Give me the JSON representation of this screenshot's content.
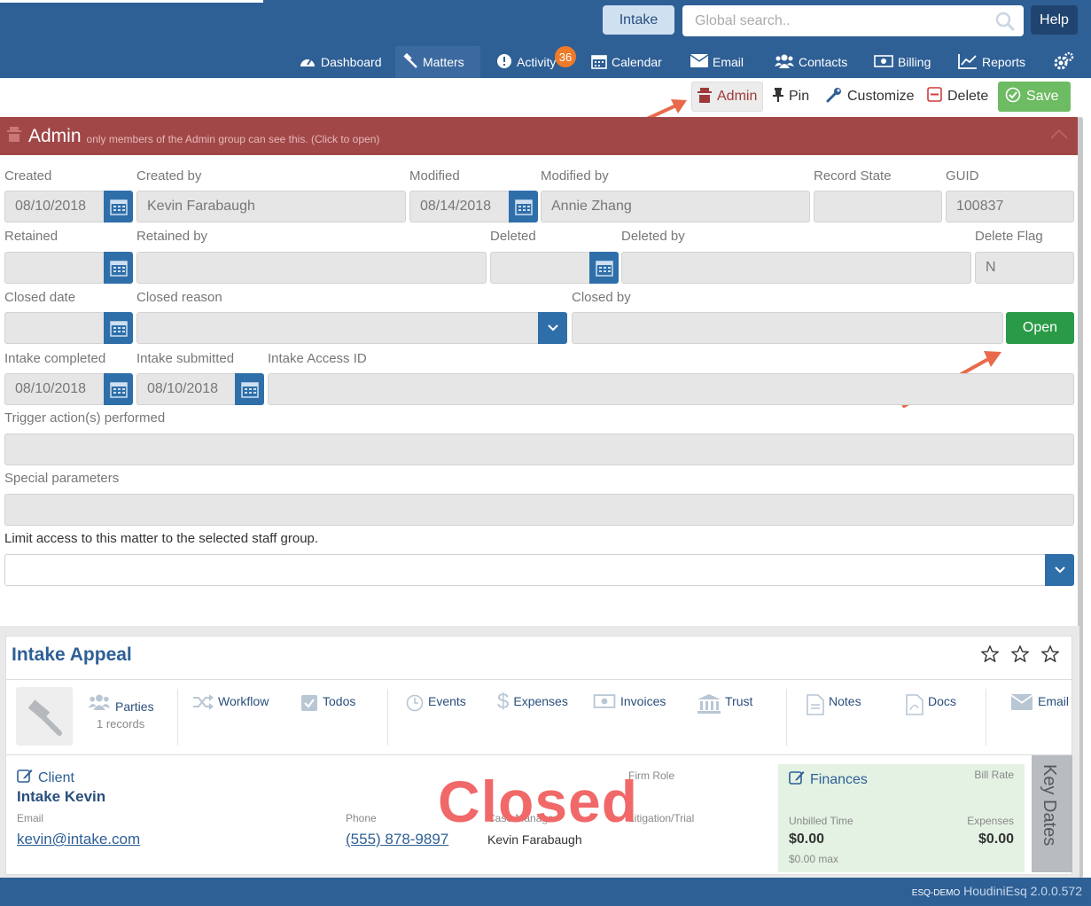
{
  "header": {
    "intake_label": "Intake",
    "search_placeholder": "Global search..",
    "help_label": "Help"
  },
  "nav": {
    "dashboard": "Dashboard",
    "matters": "Matters",
    "activity": "Activity",
    "activity_badge": "36",
    "calendar": "Calendar",
    "email": "Email",
    "contacts": "Contacts",
    "billing": "Billing",
    "reports": "Reports"
  },
  "actions": {
    "admin": "Admin",
    "pin": "Pin",
    "customize": "Customize",
    "delete": "Delete",
    "save": "Save"
  },
  "admin_section": {
    "title": "Admin",
    "subtitle": "only members of the Admin group can see this. (Click to open)"
  },
  "form": {
    "created_label": "Created",
    "created_value": "08/10/2018",
    "created_by_label": "Created by",
    "created_by_value": "Kevin Farabaugh",
    "modified_label": "Modified",
    "modified_value": "08/14/2018",
    "modified_by_label": "Modified by",
    "modified_by_value": "Annie Zhang",
    "record_state_label": "Record State",
    "record_state_value": "",
    "guid_label": "GUID",
    "guid_value": "100837",
    "retained_label": "Retained",
    "retained_by_label": "Retained by",
    "deleted_label": "Deleted",
    "deleted_by_label": "Deleted by",
    "delete_flag_label": "Delete Flag",
    "delete_flag_value": "N",
    "closed_date_label": "Closed date",
    "closed_reason_label": "Closed reason",
    "closed_by_label": "Closed by",
    "open_button": "Open",
    "intake_completed_label": "Intake completed",
    "intake_completed_value": "08/10/2018",
    "intake_submitted_label": "Intake submitted",
    "intake_submitted_value": "08/10/2018",
    "intake_access_id_label": "Intake Access ID",
    "trigger_label": "Trigger action(s) performed",
    "special_params_label": "Special parameters",
    "limit_access_label": "Limit access to this matter to the selected staff group."
  },
  "matter": {
    "title": "Intake Appeal",
    "tabs": [
      {
        "label": "Parties",
        "sub": "1 records"
      },
      {
        "label": "Workflow"
      },
      {
        "label": "Todos"
      },
      {
        "label": "Events"
      },
      {
        "label": "Expenses"
      },
      {
        "label": "Invoices"
      },
      {
        "label": "Trust"
      },
      {
        "label": "Notes"
      },
      {
        "label": "Docs"
      },
      {
        "label": "Email"
      }
    ],
    "client_heading": "Client",
    "client_name": "Intake Kevin",
    "email_label": "Email",
    "email_value": "kevin@intake.com",
    "phone_label": "Phone",
    "phone_value": "(555) 878-9897",
    "firm_role_label": "Firm Role",
    "case_manager_label": "Case Manager",
    "case_manager_value": "Kevin Farabaugh",
    "litigation_label": "Litigation/Trial",
    "closed_stamp": "Closed",
    "finances_heading": "Finances",
    "bill_rate_label": "Bill Rate",
    "unbilled_label": "Unbilled Time",
    "unbilled_value": "$0.00",
    "unbilled_max": "$0.00 max",
    "expenses_label": "Expenses",
    "expenses_value": "$0.00",
    "key_dates": "Key Dates"
  },
  "footer": {
    "env": "ESQ-DEMO",
    "product": "HoudiniEsq 2.0.0.572"
  },
  "colors": {
    "brand": "#2e5f95",
    "admin_red": "#a14747",
    "open_green": "#2a9a47",
    "save_green": "#6dbb63",
    "closed_stamp": "#f16868"
  }
}
